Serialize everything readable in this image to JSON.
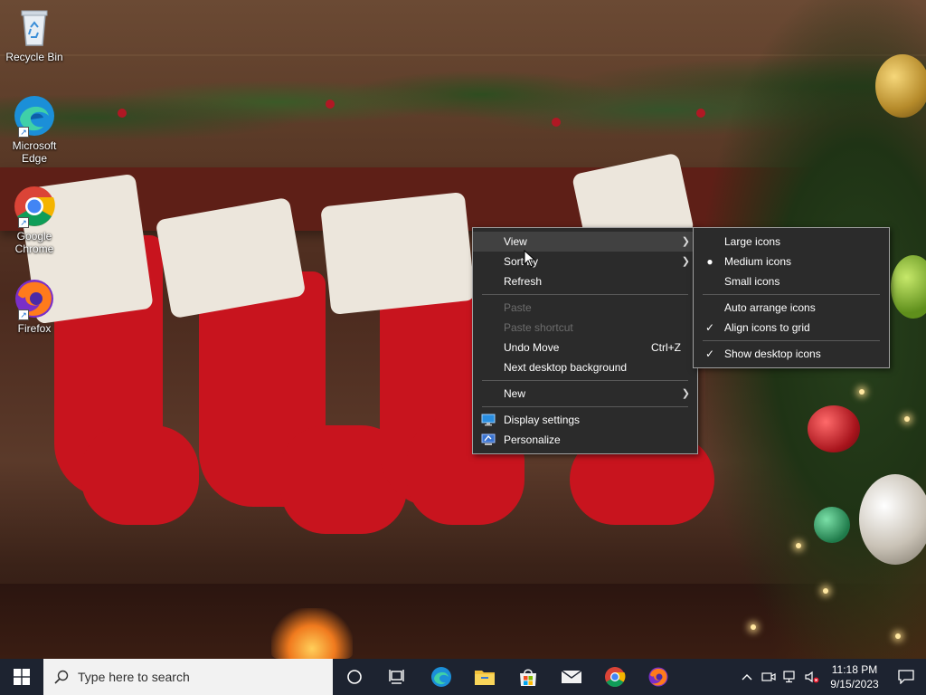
{
  "desktop": {
    "icons": [
      {
        "label": "Recycle Bin",
        "icon": "recycle-bin-icon"
      },
      {
        "label": "Microsoft Edge",
        "icon": "edge-icon"
      },
      {
        "label": "Google Chrome",
        "icon": "chrome-icon"
      },
      {
        "label": "Firefox",
        "icon": "firefox-icon"
      }
    ]
  },
  "context_menu": {
    "view": "View",
    "sort_by": "Sort by",
    "refresh": "Refresh",
    "paste": "Paste",
    "paste_shortcut": "Paste shortcut",
    "undo_move": "Undo Move",
    "undo_shortcut": "Ctrl+Z",
    "next_background": "Next desktop background",
    "new": "New",
    "display_settings": "Display settings",
    "personalize": "Personalize"
  },
  "view_submenu": {
    "large_icons": "Large icons",
    "medium_icons": "Medium icons",
    "small_icons": "Small icons",
    "auto_arrange": "Auto arrange icons",
    "align_grid": "Align icons to grid",
    "show_desktop_icons": "Show desktop icons",
    "selected_size": "Medium icons",
    "checked": [
      "Align icons to grid",
      "Show desktop icons"
    ]
  },
  "taskbar": {
    "search_placeholder": "Type here to search",
    "pinned": [
      "task-view-icon",
      "edge-icon",
      "file-explorer-icon",
      "microsoft-store-icon",
      "mail-icon",
      "chrome-icon",
      "firefox-icon"
    ],
    "clock_time": "11:18 PM",
    "clock_date": "9/15/2023"
  },
  "colors": {
    "menu_bg": "#2b2b2b",
    "menu_highlight": "#414141",
    "taskbar_bg": "#1d2330",
    "accent": "#0078d7"
  }
}
